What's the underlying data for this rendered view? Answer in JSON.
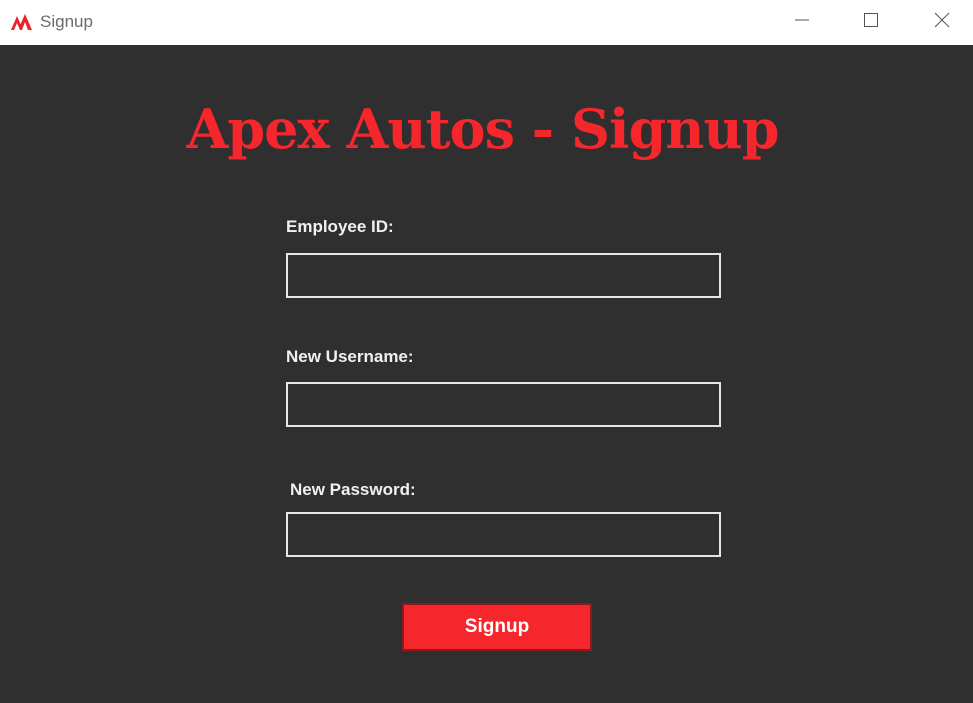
{
  "window": {
    "title": "Signup",
    "icon": "apex-logo-icon",
    "controls": [
      "minimize-icon",
      "maximize-icon",
      "close-icon"
    ]
  },
  "form": {
    "heading": "Apex Autos - Signup",
    "fields": [
      {
        "label": "Employee ID:",
        "value": "",
        "placeholder": ""
      },
      {
        "label": "New Username:",
        "value": "",
        "placeholder": ""
      },
      {
        "label": "New Password:",
        "value": "",
        "placeholder": ""
      }
    ],
    "submit_label": "Signup"
  },
  "colors": {
    "accent": "#f5262c",
    "background": "#2f2f2f",
    "titlebar": "#ffffff",
    "label_text": "#f0f0f0",
    "input_border": "#e6e6e6"
  }
}
